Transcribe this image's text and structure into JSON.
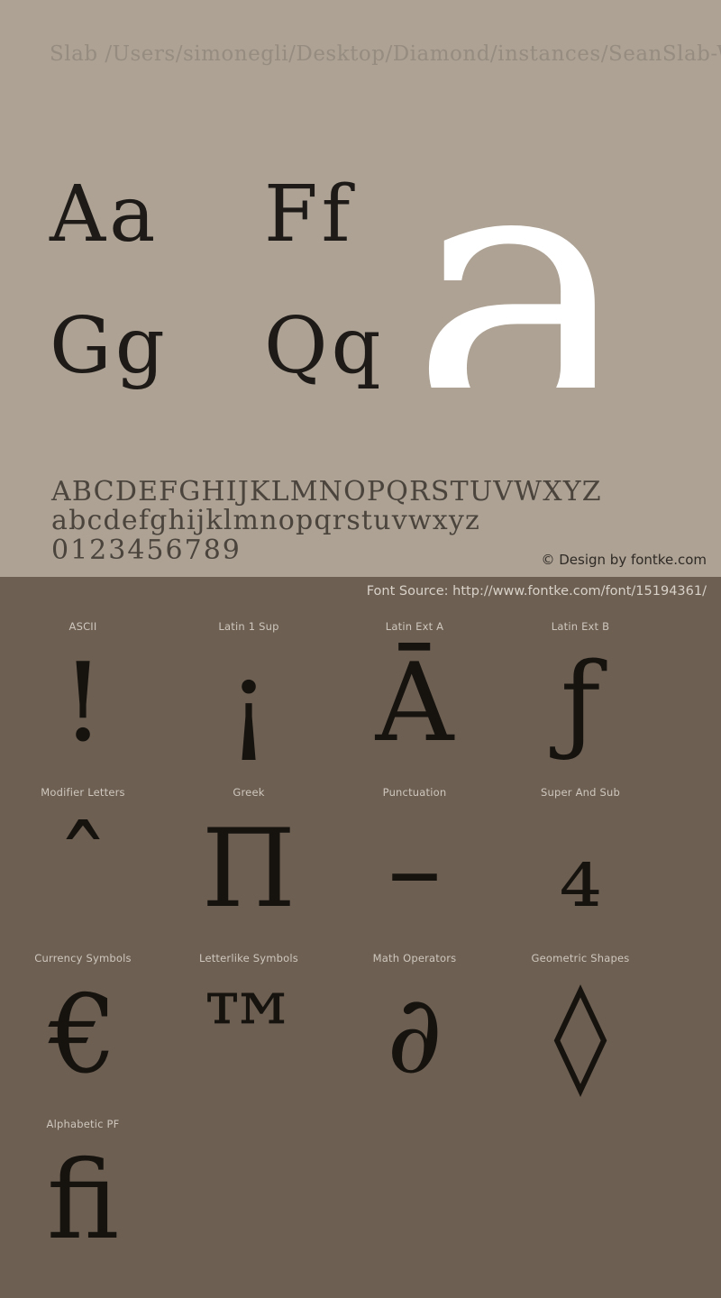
{
  "specimen": {
    "background_color": "#ada294",
    "title": "Slab /Users/simonegli/Desktop/Diamond/instances/SeanSlab-W",
    "letter_pairs": [
      "Aa",
      "Ff",
      "Gg",
      "Qq"
    ],
    "showcase_glyph": "a",
    "showcase_glyph_color": "#ffffff",
    "alphabet_uppercase": "ABCDEFGHIJKLMNOPQRSTUVWXYZ",
    "alphabet_lowercase": "abcdefghijklmnopqrstuvwxyz",
    "digits": "0123456789",
    "copyright": "© Design by fontke.com"
  },
  "ranges": {
    "background_color": "#6d5f52",
    "font_source": "Font Source: http://www.fontke.com/font/15194361/",
    "items": [
      {
        "label": "ASCII",
        "glyph": "!"
      },
      {
        "label": "Latin 1 Sup",
        "glyph": "¡"
      },
      {
        "label": "Latin Ext A",
        "glyph": "Ā"
      },
      {
        "label": "Latin Ext B",
        "glyph": "ƒ"
      },
      {
        "label": "Modifier Letters",
        "glyph": "ˆ"
      },
      {
        "label": "Greek",
        "glyph": "Π"
      },
      {
        "label": "Punctuation",
        "glyph": "–"
      },
      {
        "label": "Super And Sub",
        "glyph": "₄"
      },
      {
        "label": "Currency Symbols",
        "glyph": "€"
      },
      {
        "label": "Letterlike Symbols",
        "glyph": "™"
      },
      {
        "label": "Math Operators",
        "glyph": "∂"
      },
      {
        "label": "Geometric Shapes",
        "glyph": "◊"
      },
      {
        "label": "Alphabetic PF",
        "glyph": "ﬁ"
      }
    ]
  }
}
